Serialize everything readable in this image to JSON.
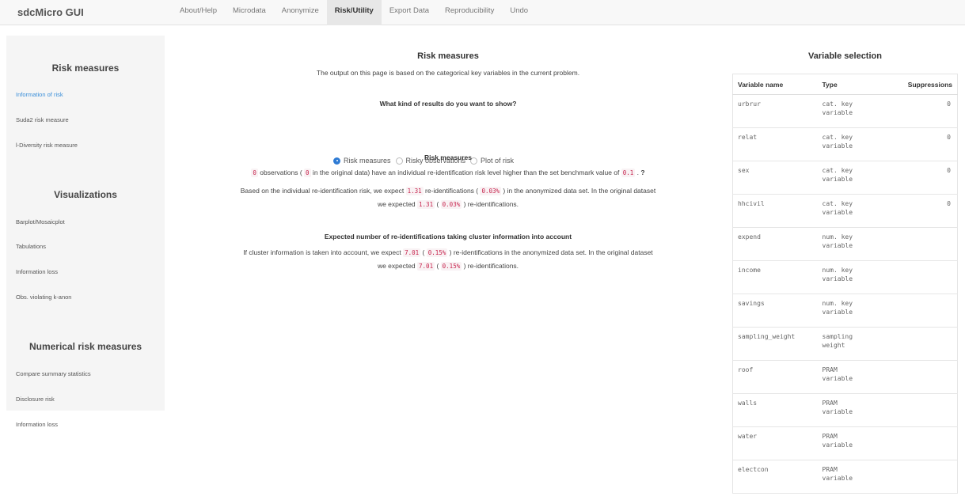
{
  "brand": "sdcMicro GUI",
  "nav": {
    "tabs": [
      "About/Help",
      "Microdata",
      "Anonymize",
      "Risk/Utility",
      "Export Data",
      "Reproducibility",
      "Undo"
    ],
    "active": "Risk/Utility"
  },
  "sidebar": {
    "section1_title": "Risk measures",
    "section1_items": [
      "Information of risk",
      "Suda2 risk measure",
      "l-Diversity risk measure"
    ],
    "section2_title": "Visualizations",
    "section2_items": [
      "Barplot/Mosaicplot",
      "Tabulations",
      "Information loss",
      "Obs. violating k-anon"
    ],
    "section3_title": "Numerical risk measures",
    "section3_items": [
      "Compare summary statistics",
      "Disclosure risk",
      "Information loss"
    ],
    "active_item": "Information of risk"
  },
  "main": {
    "title": "Risk measures",
    "intro": "The output on this page is based on the categorical key variables in the current problem.",
    "question": "What kind of results do you want to show?",
    "radio_options": [
      "Risk measures",
      "Risky observations",
      "Plot of risk"
    ],
    "radio_selected": "Risk measures",
    "risk_heading": "Risk measures",
    "obs_count": "0",
    "obs_text_1": " observations ( ",
    "obs_orig": "0",
    "obs_text_2": " in the original data) have an individual re-identification risk level higher than the set benchmark value of ",
    "benchmark": "0.1",
    "obs_text_3": " . ",
    "help_mark": "?",
    "reid_text_1": "Based on the individual re-identification risk, we expect ",
    "reid_value": "1.31",
    "reid_text_2": " re-identifications ( ",
    "reid_pct": "0.03%",
    "reid_text_3": " ) in the anonymized data set. In the original dataset",
    "reid_text_4": "we expected ",
    "reid_orig_value": "1.31",
    "reid_text_5": " ( ",
    "reid_orig_pct": "0.03%",
    "reid_text_6": " ) re-identifications.",
    "cluster_heading": "Expected number of re-identifications taking cluster information into account",
    "cluster_text_1": "If cluster information is taken into account, we expect ",
    "cluster_value": "7.01",
    "cluster_text_2": " ( ",
    "cluster_pct": "0.15%",
    "cluster_text_3": " ) re-identifications in the anonymized data set. In the original dataset",
    "cluster_text_4": "we expected ",
    "cluster_orig_value": "7.01",
    "cluster_text_5": " ( ",
    "cluster_orig_pct": "0.15%",
    "cluster_text_6": " ) re-identifications."
  },
  "variable_selection": {
    "title": "Variable selection",
    "columns": [
      "Variable name",
      "Type",
      "Suppressions"
    ],
    "rows": [
      {
        "name": "urbrur",
        "type_1": "cat. key",
        "type_2": "variable",
        "suppressions": "0"
      },
      {
        "name": "relat",
        "type_1": "cat. key",
        "type_2": "variable",
        "suppressions": "0"
      },
      {
        "name": "sex",
        "type_1": "cat. key",
        "type_2": "variable",
        "suppressions": "0"
      },
      {
        "name": "hhcivil",
        "type_1": "cat. key",
        "type_2": "variable",
        "suppressions": "0"
      },
      {
        "name": "expend",
        "type_1": "num. key",
        "type_2": "variable",
        "suppressions": ""
      },
      {
        "name": "income",
        "type_1": "num. key",
        "type_2": "variable",
        "suppressions": ""
      },
      {
        "name": "savings",
        "type_1": "num. key",
        "type_2": "variable",
        "suppressions": ""
      },
      {
        "name": "sampling_weight",
        "type_1": "sampling",
        "type_2": "weight",
        "suppressions": ""
      },
      {
        "name": "roof",
        "type_1": "PRAM",
        "type_2": "variable",
        "suppressions": ""
      },
      {
        "name": "walls",
        "type_1": "PRAM",
        "type_2": "variable",
        "suppressions": ""
      },
      {
        "name": "water",
        "type_1": "PRAM",
        "type_2": "variable",
        "suppressions": ""
      },
      {
        "name": "electcon",
        "type_1": "PRAM",
        "type_2": "variable",
        "suppressions": ""
      }
    ]
  }
}
